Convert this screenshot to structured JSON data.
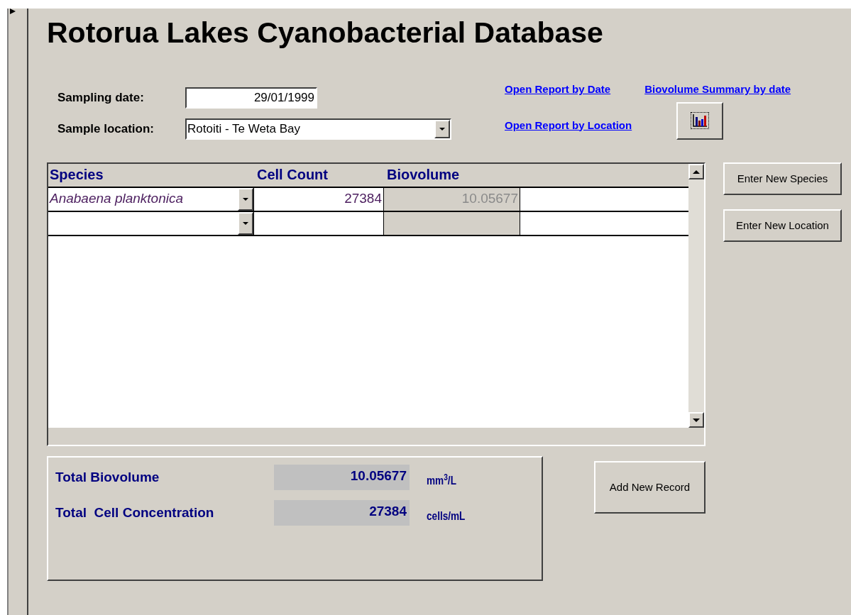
{
  "title": "Rotorua Lakes Cyanobacterial Database",
  "sampling_date": {
    "label": "Sampling date:",
    "value": "29/01/1999"
  },
  "sample_location": {
    "label": "Sample location:",
    "value": "Rotoiti - Te Weta Bay"
  },
  "links": [
    "Open Report by Date",
    "Biovolume Summary by date",
    "Open Report by Location"
  ],
  "side_buttons": [
    "Enter New Species",
    "Enter New Location"
  ],
  "table": {
    "columns": [
      "Species",
      "Cell Count",
      "Biovolume"
    ],
    "rows": [
      {
        "species": "Anabaena planktonica",
        "cell_count": "27384",
        "biovolume": "10.05677"
      },
      {}
    ]
  },
  "totals": [
    {
      "label": "Total Biovolume",
      "value": "10.05677",
      "unit": "mm$^{3}$/L"
    },
    {
      "label": "Total  Cell Concentration",
      "value": "27384",
      "unit": "cells/mL"
    }
  ],
  "add_button": "Add New Record"
}
